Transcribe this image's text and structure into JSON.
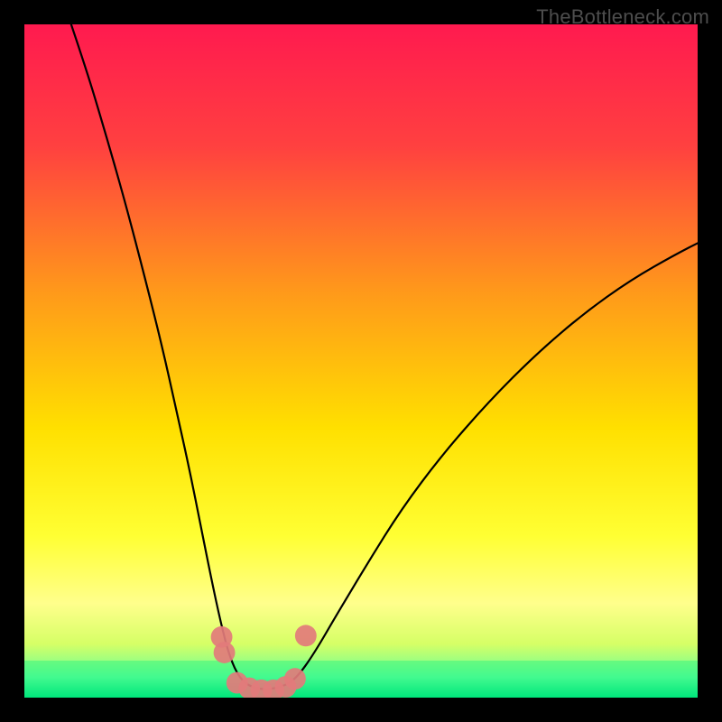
{
  "watermark": "TheBottleneck.com",
  "chart_data": {
    "type": "line",
    "title": "",
    "xlabel": "",
    "ylabel": "",
    "xlim": [
      0,
      1
    ],
    "ylim": [
      0,
      1
    ],
    "background_gradient": {
      "stops": [
        {
          "offset": 0.0,
          "color": "#ff1a4f"
        },
        {
          "offset": 0.18,
          "color": "#ff4040"
        },
        {
          "offset": 0.4,
          "color": "#ff9a1a"
        },
        {
          "offset": 0.6,
          "color": "#ffe000"
        },
        {
          "offset": 0.76,
          "color": "#ffff33"
        },
        {
          "offset": 0.86,
          "color": "#ffff8c"
        },
        {
          "offset": 0.92,
          "color": "#d6ff66"
        },
        {
          "offset": 0.97,
          "color": "#66ff99"
        },
        {
          "offset": 1.0,
          "color": "#00e07a"
        }
      ]
    },
    "green_band": {
      "y_top": 0.055,
      "color": "#00f07e"
    },
    "series": [
      {
        "name": "curve-left",
        "stroke": "#000000",
        "width": 2.2,
        "points": [
          {
            "x": 0.06,
            "y": 1.028
          },
          {
            "x": 0.09,
            "y": 0.94
          },
          {
            "x": 0.12,
            "y": 0.84
          },
          {
            "x": 0.15,
            "y": 0.735
          },
          {
            "x": 0.18,
            "y": 0.62
          },
          {
            "x": 0.205,
            "y": 0.52
          },
          {
            "x": 0.225,
            "y": 0.43
          },
          {
            "x": 0.245,
            "y": 0.34
          },
          {
            "x": 0.262,
            "y": 0.255
          },
          {
            "x": 0.278,
            "y": 0.175
          },
          {
            "x": 0.292,
            "y": 0.11
          },
          {
            "x": 0.305,
            "y": 0.06
          },
          {
            "x": 0.32,
            "y": 0.028
          },
          {
            "x": 0.338,
            "y": 0.015
          },
          {
            "x": 0.36,
            "y": 0.012
          }
        ]
      },
      {
        "name": "curve-right",
        "stroke": "#000000",
        "width": 2.2,
        "points": [
          {
            "x": 0.36,
            "y": 0.012
          },
          {
            "x": 0.385,
            "y": 0.016
          },
          {
            "x": 0.405,
            "y": 0.03
          },
          {
            "x": 0.43,
            "y": 0.065
          },
          {
            "x": 0.465,
            "y": 0.125
          },
          {
            "x": 0.51,
            "y": 0.2
          },
          {
            "x": 0.56,
            "y": 0.28
          },
          {
            "x": 0.62,
            "y": 0.36
          },
          {
            "x": 0.69,
            "y": 0.44
          },
          {
            "x": 0.76,
            "y": 0.51
          },
          {
            "x": 0.83,
            "y": 0.57
          },
          {
            "x": 0.9,
            "y": 0.62
          },
          {
            "x": 0.97,
            "y": 0.66
          },
          {
            "x": 1.02,
            "y": 0.685
          }
        ]
      }
    ],
    "marker_blobs": {
      "fill": "#e27b7b",
      "fill_opacity": 0.92,
      "radius": 0.016,
      "clusters": [
        {
          "name": "left-pair",
          "points": [
            {
              "x": 0.293,
              "y": 0.09
            },
            {
              "x": 0.297,
              "y": 0.067
            }
          ]
        },
        {
          "name": "bottom-run",
          "points": [
            {
              "x": 0.316,
              "y": 0.022
            },
            {
              "x": 0.334,
              "y": 0.014
            },
            {
              "x": 0.352,
              "y": 0.011
            },
            {
              "x": 0.37,
              "y": 0.011
            },
            {
              "x": 0.388,
              "y": 0.016
            },
            {
              "x": 0.402,
              "y": 0.028
            }
          ]
        },
        {
          "name": "right-dot",
          "points": [
            {
              "x": 0.418,
              "y": 0.092
            }
          ]
        }
      ]
    }
  }
}
